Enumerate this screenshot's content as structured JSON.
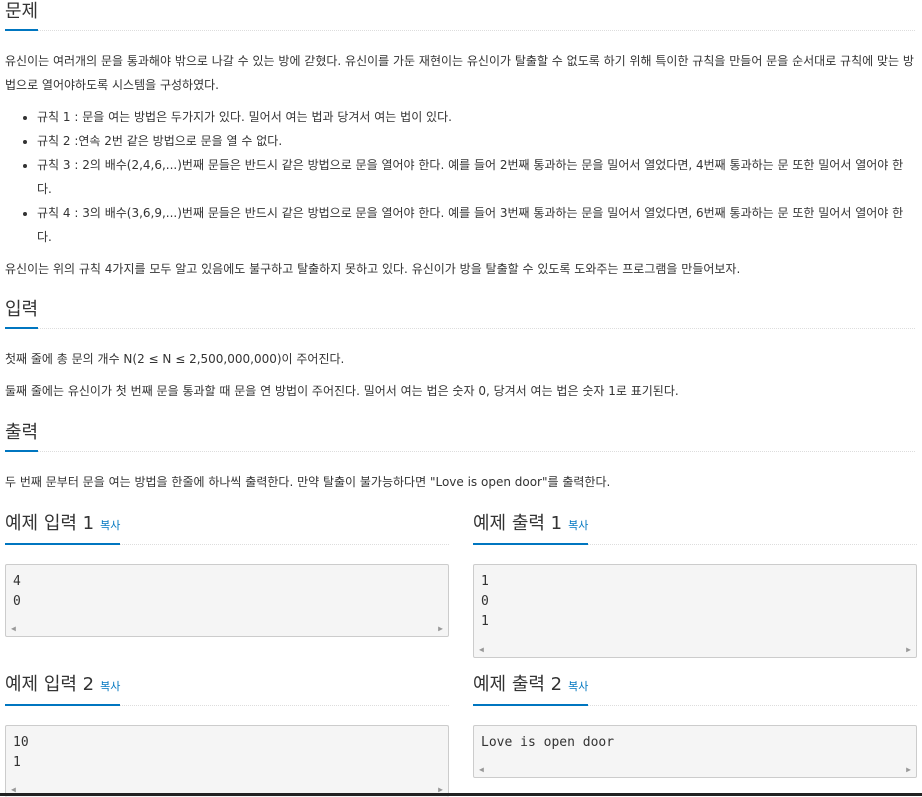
{
  "problem": {
    "title": "문제",
    "intro": "유신이는 여러개의 문을 통과해야 밖으로 나갈 수 있는 방에 갇혔다. 유신이를 가둔 재현이는 유신이가 탈출할 수 없도록 하기 위해 특이한 규칙을 만들어 문을 순서대로 규칙에 맞는 방법으로 열어야하도록 시스템을 구성하였다.",
    "rules": [
      "규칙 1 : 문을 여는 방법은 두가지가 있다. 밀어서 여는 법과 당겨서 여는 법이 있다.",
      "규칙 2 :연속 2번 같은 방법으로 문을 열 수 없다.",
      "규칙 3 : 2의 배수(2,4,6,...)번째 문들은 반드시 같은 방법으로 문을 열어야 한다. 예를 들어 2번째 통과하는 문을 밀어서 열었다면, 4번째 통과하는 문 또한 밀어서 열어야 한다.",
      "규칙 4 : 3의 배수(3,6,9,...)번째 문들은 반드시 같은 방법으로 문을 열어야 한다. 예를 들어 3번째 통과하는 문을 밀어서 열었다면, 6번째 통과하는 문 또한 밀어서 열어야 한다."
    ],
    "outro": "유신이는 위의 규칙 4가지를 모두 알고 있음에도 불구하고 탈출하지 못하고 있다. 유신이가 방을 탈출할 수 있도록 도와주는 프로그램을 만들어보자."
  },
  "input": {
    "title": "입력",
    "line1": "첫째 줄에 총 문의 개수 N(2 ≤ N ≤ 2,500,000,000)이 주어진다.",
    "line2": "둘째 줄에는 유신이가 첫 번째 문을 통과할 때 문을 연 방법이 주어진다. 밀어서 여는 법은 숫자 0, 당겨서 여는 법은 숫자 1로 표기된다."
  },
  "output": {
    "title": "출력",
    "line1": "두 번째 문부터 문을 여는 방법을 한줄에 하나씩 출력한다. 만약 탈출이 불가능하다면 \"Love is open door\"를 출력한다."
  },
  "copy_label": "복사",
  "samples": {
    "in1_title": "예제 입력 1",
    "in1": "4\n0",
    "out1_title": "예제 출력 1",
    "out1": "1\n0\n1",
    "in2_title": "예제 입력 2",
    "in2": "10\n1",
    "out2_title": "예제 출력 2",
    "out2": "Love is open door"
  }
}
